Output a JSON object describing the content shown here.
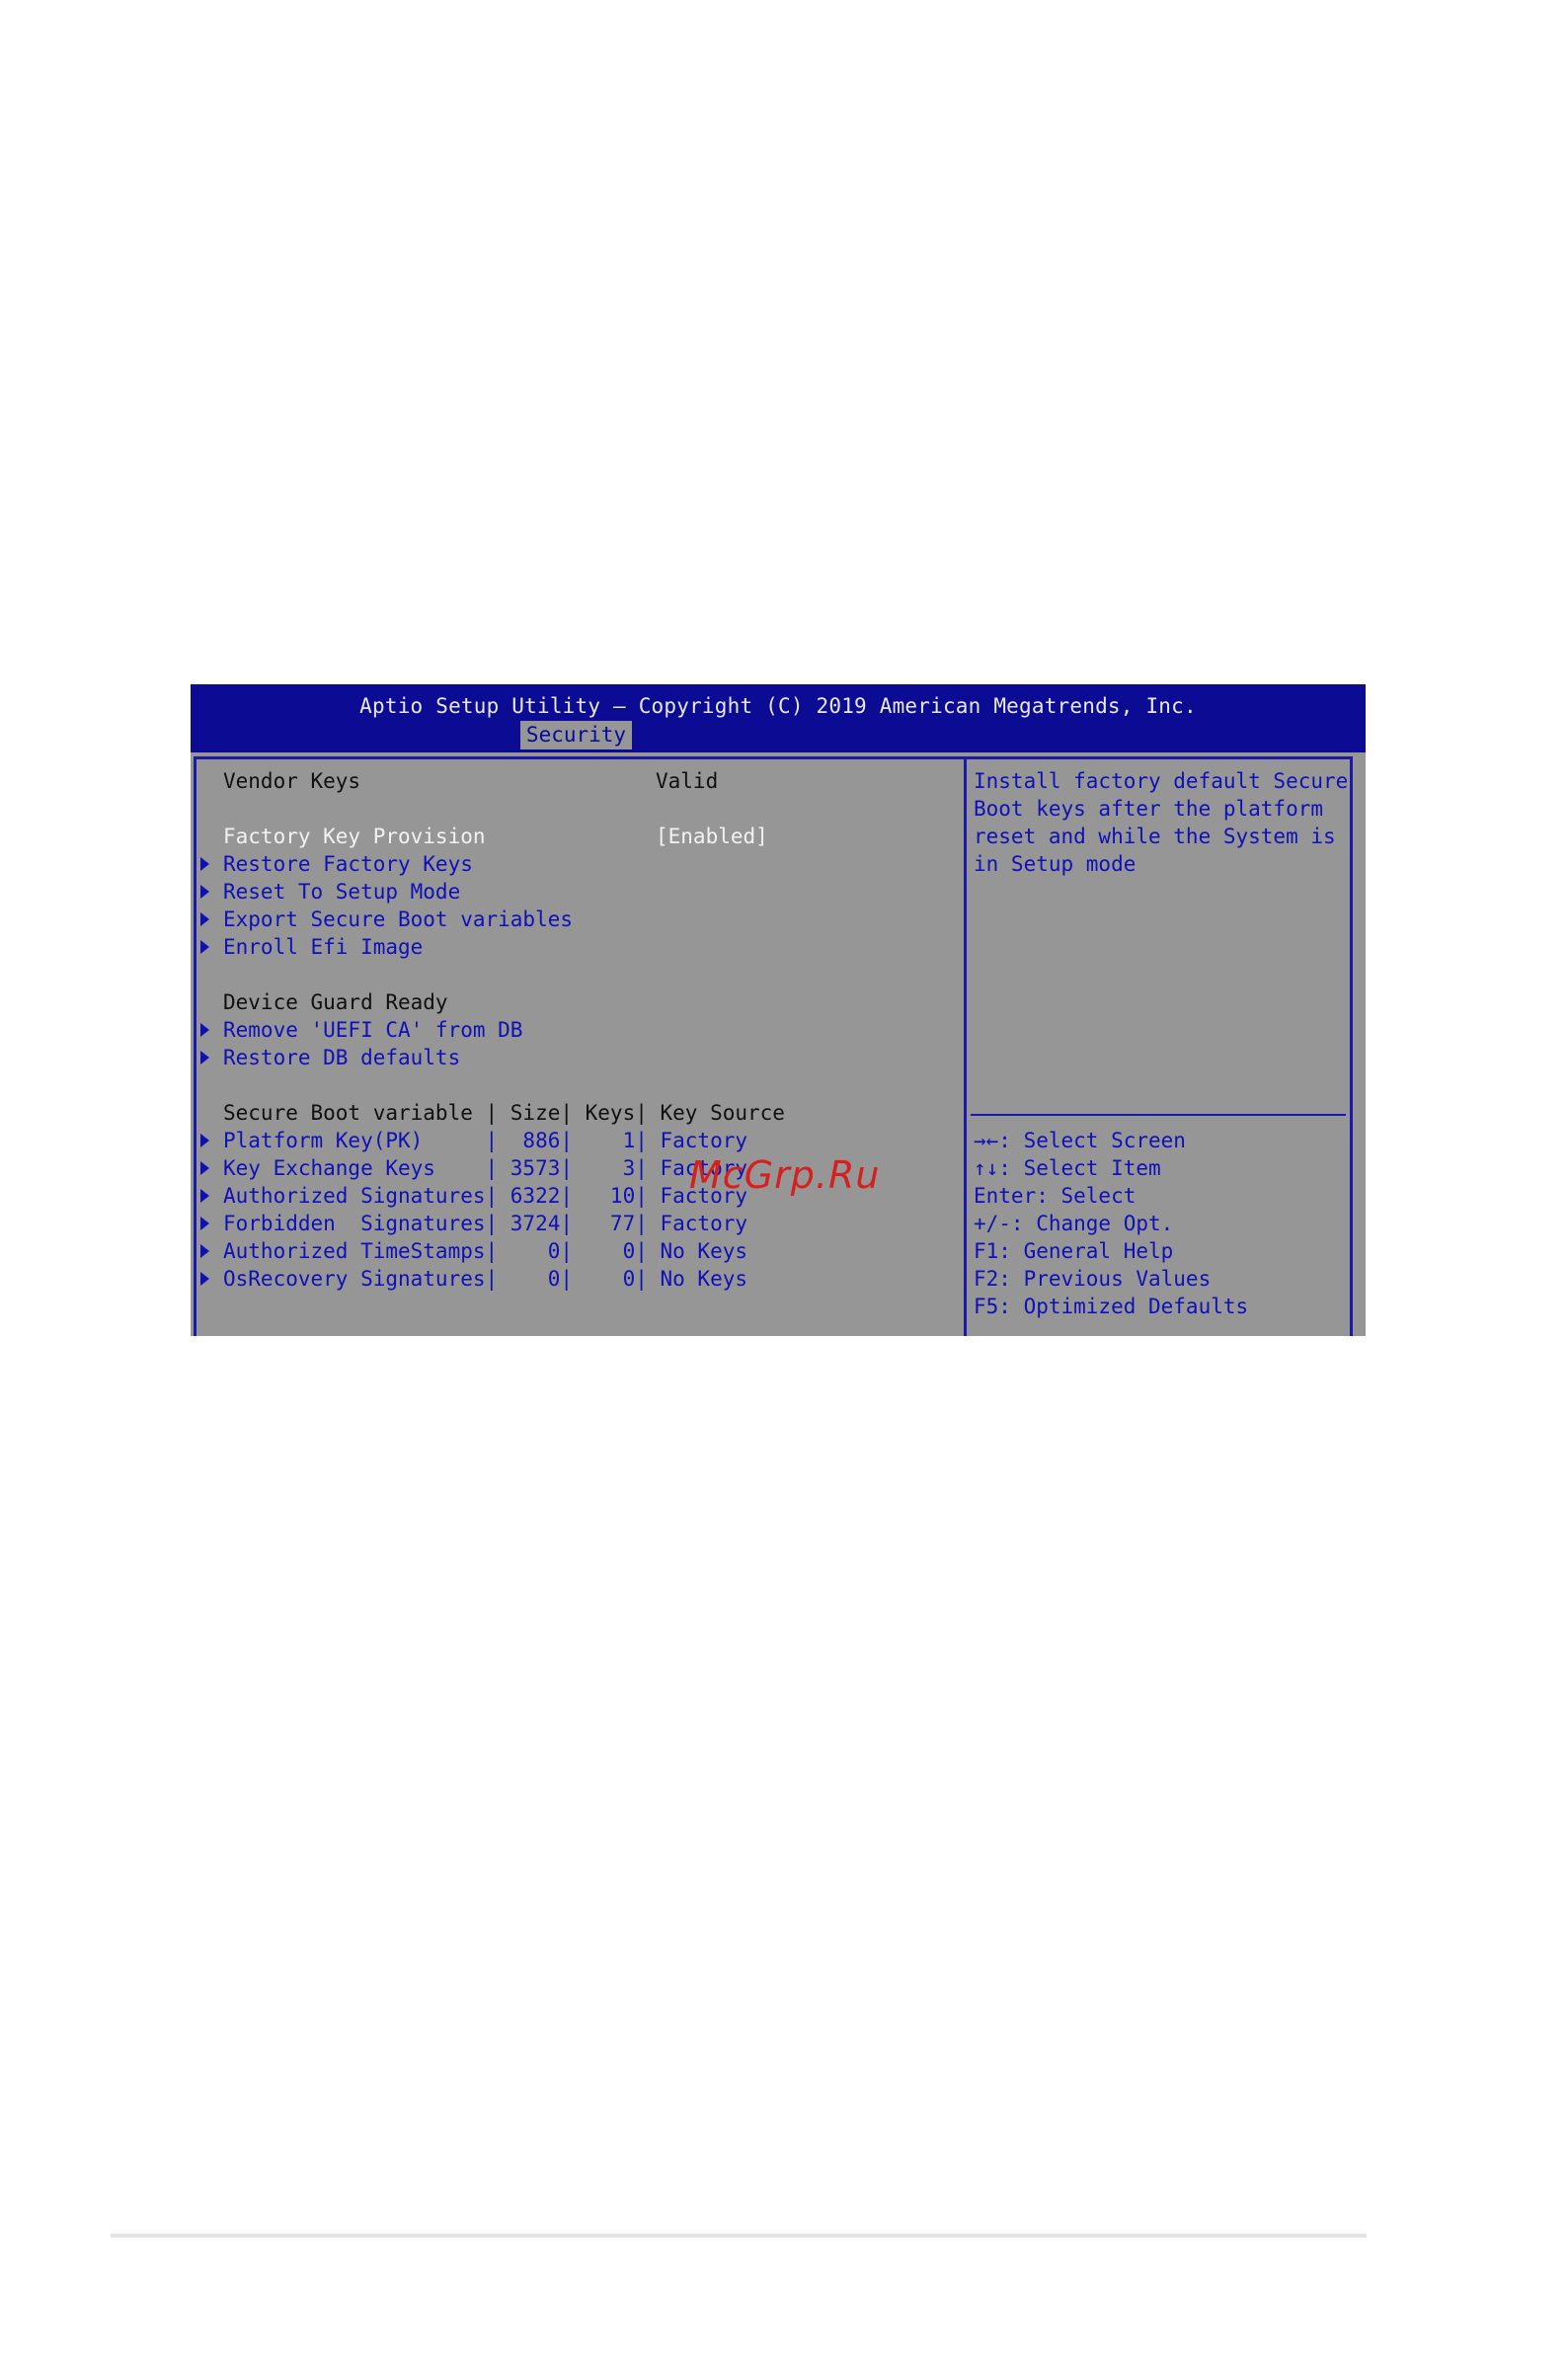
{
  "header": {
    "title": "Aptio Setup Utility – Copyright (C) 2019 American Megatrends, Inc.",
    "active_tab": "Security"
  },
  "left": {
    "vendor_keys": {
      "label": "Vendor Keys",
      "value": "Valid"
    },
    "factory_key_provision": {
      "label": "Factory Key Provision",
      "value": "[Enabled]"
    },
    "menu1": [
      "Restore Factory Keys",
      "Reset To Setup Mode",
      "Export Secure Boot variables",
      "Enroll Efi Image"
    ],
    "device_guard_ready": "Device Guard Ready",
    "menu2": [
      "Remove 'UEFI CA' from DB",
      "Restore DB defaults"
    ],
    "table": {
      "header": "Secure Boot variable | Size| Keys| Key Source",
      "rows": [
        "Platform Key(PK)     |  886|    1| Factory",
        "Key Exchange Keys    | 3573|    3| Factory",
        "Authorized Signatures| 6322|   10| Factory",
        "Forbidden  Signatures| 3724|   77| Factory",
        "Authorized TimeStamps|    0|    0| No Keys",
        "OsRecovery Signatures|    0|    0| No Keys"
      ]
    }
  },
  "help": {
    "description": [
      "Install factory default Secure",
      "Boot keys after the platform",
      "reset and while the System is",
      "in Setup mode"
    ],
    "keys": [
      "→←: Select Screen",
      "↑↓: Select Item",
      "Enter: Select",
      "+/-: Change Opt.",
      "F1: General Help",
      "F2: Previous Values",
      "F5: Optimized Defaults"
    ]
  },
  "watermark": "McGrp.Ru",
  "colors": {
    "title_bar": "#0b0b93",
    "panel": "#969696",
    "link_text": "#1010b8",
    "watermark": "#d62020"
  }
}
